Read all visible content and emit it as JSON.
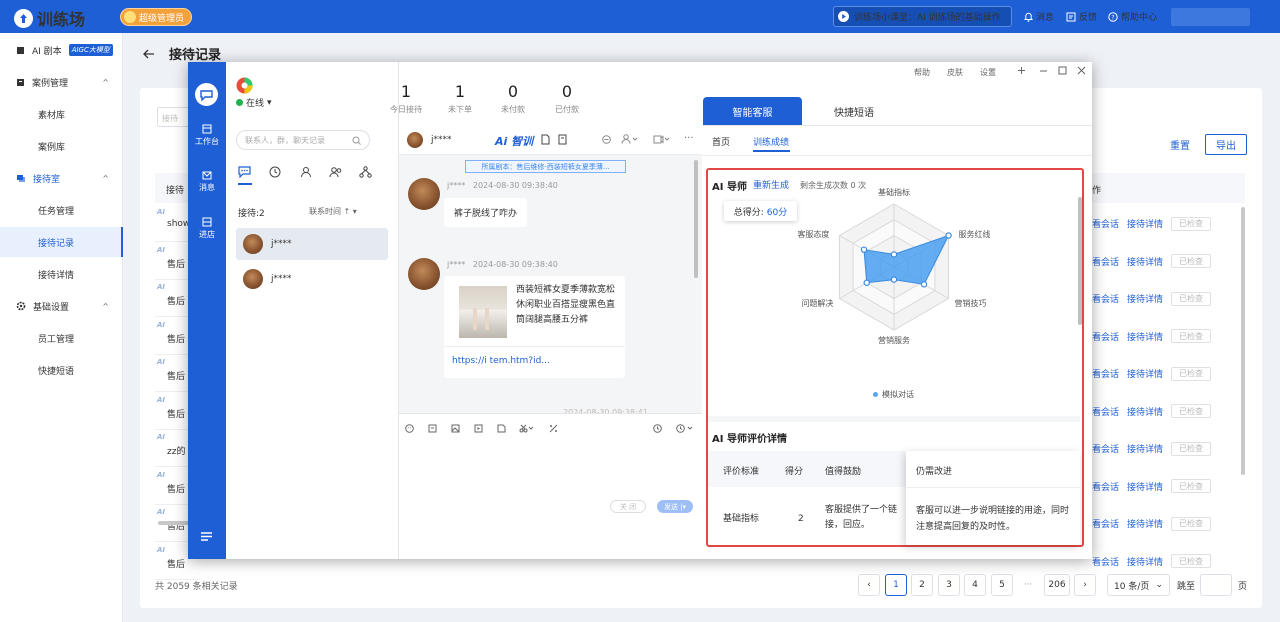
{
  "topbar": {
    "app_name": "训练场",
    "role_badge": "超级管理员",
    "lesson": "训练场小课堂：AI 训练场的基础操作",
    "messages": "消息",
    "feedback": "反馈",
    "help": "帮助中心"
  },
  "sidebar": {
    "items": [
      {
        "label": "AI 剧本",
        "badge": "AIGC大模型",
        "type": "group",
        "icon": "ai-script-icon"
      },
      {
        "label": "案例管理",
        "type": "group",
        "icon": "case-icon"
      },
      {
        "label": "素材库",
        "type": "sub"
      },
      {
        "label": "案例库",
        "type": "sub"
      },
      {
        "label": "接待室",
        "type": "group",
        "icon": "reception-icon",
        "active_group": true
      },
      {
        "label": "任务管理",
        "type": "sub"
      },
      {
        "label": "接待记录",
        "type": "sub",
        "active": true
      },
      {
        "label": "接待详情",
        "type": "sub"
      },
      {
        "label": "基础设置",
        "type": "group",
        "icon": "gear-icon"
      },
      {
        "label": "员工管理",
        "type": "sub"
      },
      {
        "label": "快捷短语",
        "type": "sub"
      }
    ]
  },
  "page": {
    "title": "接待记录",
    "filter_placeholder": "接待",
    "reset": "重置",
    "export": "导出",
    "col_first": "接待",
    "col_ops": "作",
    "rows": [
      {
        "text": "show"
      },
      {
        "text": "售后"
      },
      {
        "text": "售后"
      },
      {
        "text": "售后"
      },
      {
        "text": "售后"
      },
      {
        "text": "售后"
      },
      {
        "text": "zz的"
      },
      {
        "text": "售后"
      },
      {
        "text": "售后"
      },
      {
        "text": "售后"
      }
    ],
    "row_actions": {
      "view": "看会话",
      "detail": "接待详情",
      "check": "已检查"
    },
    "total": "共 2059 条相关记录",
    "pages": [
      "1",
      "2",
      "3",
      "4",
      "5",
      "···",
      "206"
    ],
    "page_size": "10 条/页",
    "jump": "跳至",
    "page_unit": "页"
  },
  "dialog": {
    "controls": {
      "help": "帮助",
      "skin": "皮肤",
      "settings": "设置"
    },
    "strip": {
      "workbench": "工作台",
      "messages": "消息",
      "enter_shop": "进店"
    },
    "status": "在线",
    "stats": [
      {
        "value": "1",
        "label": "今日接待"
      },
      {
        "value": "1",
        "label": "未下单"
      },
      {
        "value": "0",
        "label": "未付款"
      },
      {
        "value": "0",
        "label": "已付款"
      }
    ],
    "search_placeholder": "联系人，群，聊天记录",
    "reception_count": "接待:2",
    "sort": "联系时间",
    "contacts": [
      {
        "name": "j****"
      },
      {
        "name": "j****"
      }
    ],
    "chat": {
      "user": "j****",
      "ai_train": "Ai 智训",
      "scenario": "所属剧本：售后维修-西装短裤女夏季薄...",
      "messages": [
        {
          "sender": "j****",
          "time": "2024-08-30 09:38:40",
          "text": "裤子脱线了咋办"
        },
        {
          "sender": "j****",
          "time": "2024-08-30 09:38:40",
          "product": "西装短裤女夏季薄款宽松休闲职业百搭显瘦黑色直筒阔腿高腰五分裤",
          "link": "https://i tem.htm?id..."
        }
      ],
      "more_time": "2024-08-30 09:38:41",
      "close": "关 闭",
      "send": "发送"
    },
    "right": {
      "tabs": [
        "智能客服",
        "快捷短语"
      ],
      "subtabs": [
        "首页",
        "训练成绩"
      ],
      "ai_title": "AI 导师",
      "regen": "重新生成",
      "remaining": "剩余生成次数 0 次",
      "score_label": "总得分:",
      "score_value": "60分",
      "legend": "模拟对话",
      "eval_title": "AI 导师评价详情",
      "eval_headers": [
        "评价标准",
        "得分",
        "值得鼓励",
        "仍需改进"
      ],
      "eval_rows": [
        {
          "criterion": "基础指标",
          "score": "2",
          "praise": "客服提供了一个链接，回应。",
          "improve": "客服可以进一步说明链接的用途，同时注意提高回复的及时性。"
        }
      ]
    }
  },
  "chart_data": {
    "type": "radar",
    "axes": [
      "基础指标",
      "服务红线",
      "营销技巧",
      "营销服务",
      "问题解决",
      "客服态度"
    ],
    "series": [
      {
        "name": "模拟对话",
        "values": [
          0.2,
          1.0,
          0.55,
          0.2,
          0.5,
          0.55
        ]
      }
    ],
    "max": 1,
    "color": "#4a9ff0"
  }
}
